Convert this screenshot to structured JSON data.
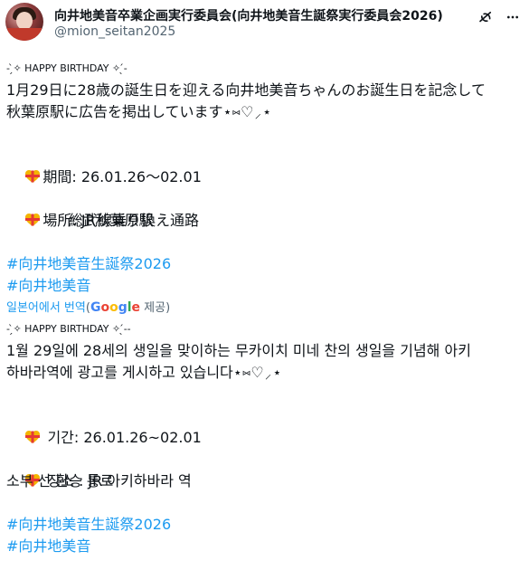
{
  "header": {
    "display_name": "向井地美音卒業企画実行委員会(向井地美音生誕祭実行委員会2026)",
    "handle": "@mion_seitan2025"
  },
  "original": {
    "banner": "- ̗̀✧ HAPPY BIRTHDAY ✧ ̖́-",
    "line1": "1月29日に28歳の誕生日を迎える向井地美音ちゃんのお誕生日を記念して",
    "line2": "秋葉原駅に広告を掲出しています⋆⑅♡⸝⋆",
    "period": "期間: 26.01.26〜02.01",
    "place": "場所: JR秋葉原駅",
    "place_detail": "総武線乗り換え通路",
    "hashtag1": "#向井地美音生誕祭2026",
    "hashtag2": "#向井地美音"
  },
  "translation": {
    "translated_from": "일본어에서 번역",
    "paren_open": "(",
    "google": "Google",
    "provided": " 제공)"
  },
  "translated": {
    "banner": "- ̗̀✧ HAPPY BIRTHDAY ✧ ̖́--",
    "line1": "1월 29일에 28세의 생일을 맞이하는 무카이치 미네 찬의 생일을 기념해 아키",
    "line2": "하바라역에 광고를 게시하고 있습니다⋆⑅♡⸝⋆",
    "period": "기간: 26.01.26~02.01",
    "place": "장소 : JR 아키하바라 역",
    "place_detail": "소부 선 환승 통로",
    "hashtag1": "#向井地美音生誕祭2026",
    "hashtag2": "#向井地美音"
  },
  "colors": {
    "text": "#0f1419",
    "secondary": "#536471",
    "link": "#1d9bf0",
    "google_blue": "#4285f4",
    "google_red": "#ea4335",
    "google_yellow": "#fbbc05",
    "google_green": "#34a853"
  },
  "icons": {
    "avatar": "avatar",
    "grok": "grok-icon",
    "more": "more-icon",
    "bullet": "heart-gift-emoji"
  }
}
